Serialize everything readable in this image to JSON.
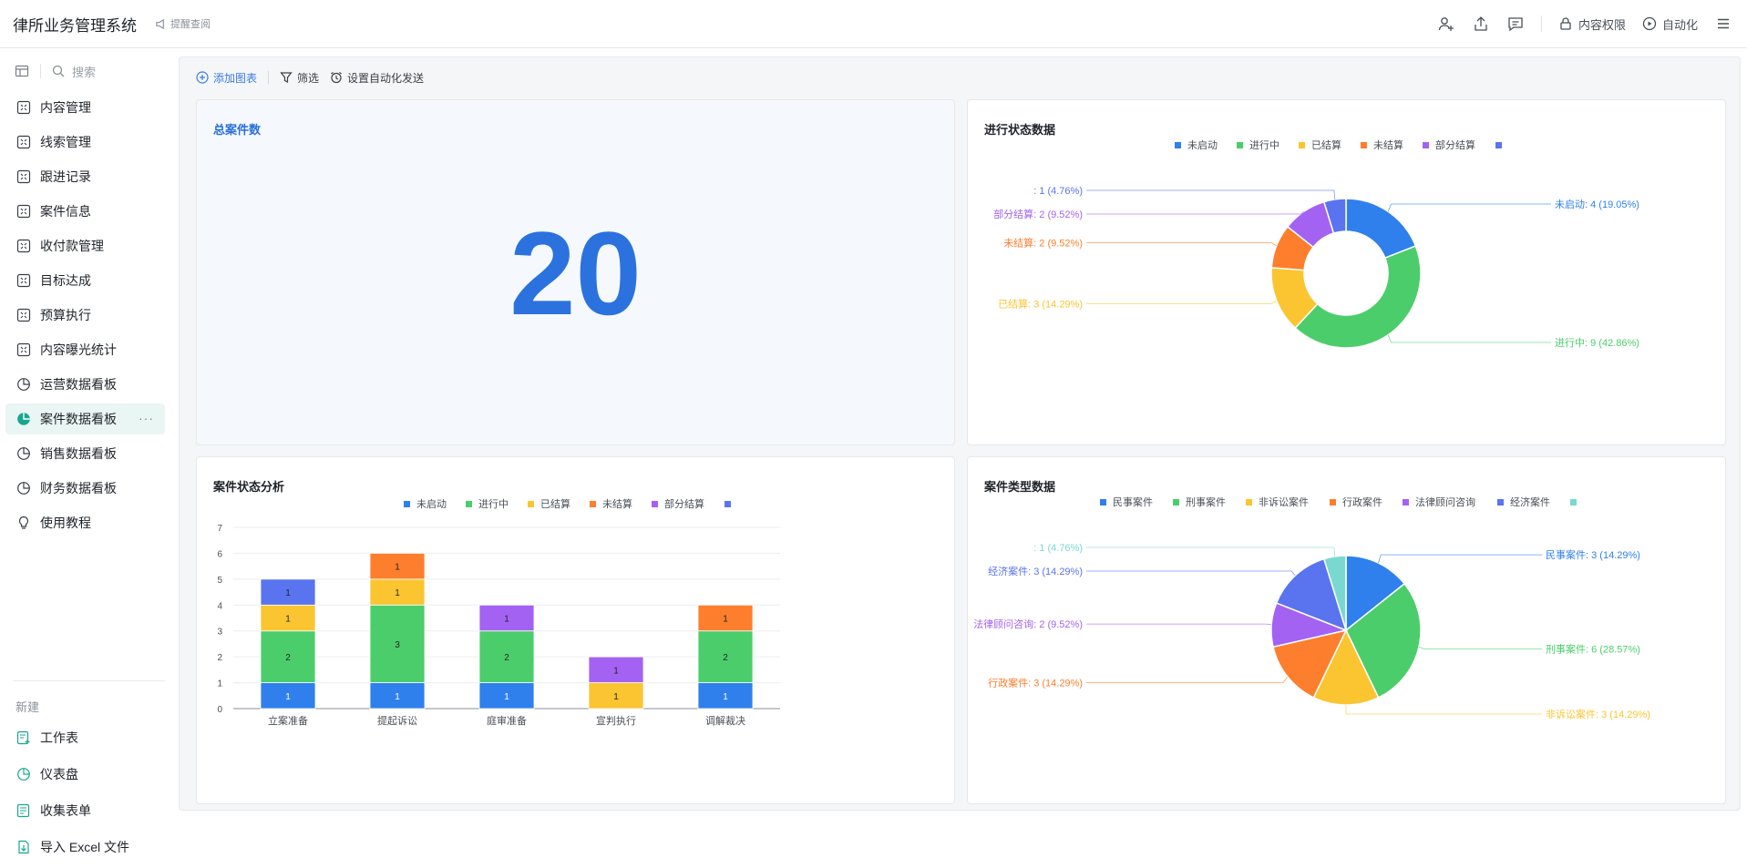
{
  "header": {
    "title": "律所业务管理系统",
    "hint": "提醒查阅",
    "buttons": {
      "permission": "内容权限",
      "automation": "自动化"
    }
  },
  "sidebar": {
    "search_placeholder": "搜索",
    "items": [
      {
        "label": "内容管理",
        "icon": "table-icon"
      },
      {
        "label": "线索管理",
        "icon": "table-icon"
      },
      {
        "label": "跟进记录",
        "icon": "table-icon"
      },
      {
        "label": "案件信息",
        "icon": "table-icon"
      },
      {
        "label": "收付款管理",
        "icon": "table-icon"
      },
      {
        "label": "目标达成",
        "icon": "table-icon"
      },
      {
        "label": "预算执行",
        "icon": "table-icon"
      },
      {
        "label": "内容曝光统计",
        "icon": "table-icon"
      },
      {
        "label": "运营数据看板",
        "icon": "pie-icon"
      },
      {
        "label": "案件数据看板",
        "icon": "pie-icon",
        "active": true,
        "more": "···"
      },
      {
        "label": "销售数据看板",
        "icon": "pie-icon"
      },
      {
        "label": "财务数据看板",
        "icon": "pie-icon"
      },
      {
        "label": "使用教程",
        "icon": "bulb-icon"
      }
    ],
    "new_section": {
      "label": "新建",
      "items": [
        {
          "label": "工作表",
          "icon": "sheet-icon"
        },
        {
          "label": "仪表盘",
          "icon": "dashboard-icon"
        },
        {
          "label": "收集表单",
          "icon": "form-icon"
        },
        {
          "label": "导入 Excel 文件",
          "icon": "import-icon"
        }
      ]
    }
  },
  "toolbar": {
    "add_chart": "添加图表",
    "filter": "筛选",
    "auto_send": "设置自动化发送"
  },
  "cards": {
    "total": {
      "title": "总案件数",
      "value": "20"
    },
    "status_pie": {
      "title": "进行状态数据"
    },
    "stacked": {
      "title": "案件状态分析"
    },
    "type_pie": {
      "title": "案件类型数据"
    }
  },
  "chart_data": [
    {
      "type": "pie",
      "variant": "donut",
      "title": "进行状态数据",
      "legend_position": "top",
      "legend": [
        "未启动",
        "进行中",
        "已结算",
        "未结算",
        "部分结算",
        ""
      ],
      "slices": [
        {
          "name": "未启动",
          "value": 4,
          "label": "未启动: 4 (19.05%)",
          "color": "#2f80ed"
        },
        {
          "name": "进行中",
          "value": 9,
          "label": "进行中: 9 (42.86%)",
          "color": "#4ccd6b"
        },
        {
          "name": "已结算",
          "value": 3,
          "label": "已结算: 3 (14.29%)",
          "color": "#fbc531"
        },
        {
          "name": "未结算",
          "value": 2,
          "label": "未结算: 2 (9.52%)",
          "color": "#fd7e2d"
        },
        {
          "name": "部分结算",
          "value": 2,
          "label": "部分结算: 2 (9.52%)",
          "color": "#a462f2"
        },
        {
          "name": "",
          "value": 1,
          "label": ": 1 (4.76%)",
          "color": "#5a74ef"
        }
      ]
    },
    {
      "type": "bar",
      "stacked": true,
      "title": "案件状态分析",
      "legend_position": "top",
      "categories": [
        "立案准备",
        "提起诉讼",
        "庭审准备",
        "宣判执行",
        "调解裁决"
      ],
      "ylim": [
        0,
        7
      ],
      "yticks": [
        "0",
        "1",
        "2",
        "3",
        "4",
        "5",
        "6",
        "7"
      ],
      "grid": true,
      "series": [
        {
          "name": "未启动",
          "color": "#2f80ed",
          "values": [
            1,
            1,
            1,
            0,
            1
          ]
        },
        {
          "name": "进行中",
          "color": "#4ccd6b",
          "values": [
            2,
            3,
            2,
            0,
            2
          ]
        },
        {
          "name": "已结算",
          "color": "#fbc531",
          "values": [
            1,
            1,
            0,
            1,
            0
          ]
        },
        {
          "name": "未结算",
          "color": "#fd7e2d",
          "values": [
            0,
            1,
            0,
            0,
            1
          ]
        },
        {
          "name": "部分结算",
          "color": "#a462f2",
          "values": [
            0,
            0,
            1,
            1,
            0
          ]
        },
        {
          "name": "",
          "color": "#5a74ef",
          "values": [
            1,
            0,
            0,
            0,
            0
          ]
        }
      ]
    },
    {
      "type": "pie",
      "title": "案件类型数据",
      "legend_position": "top",
      "legend": [
        "民事案件",
        "刑事案件",
        "非诉讼案件",
        "行政案件",
        "法律顾问咨询",
        "经济案件",
        ""
      ],
      "slices": [
        {
          "name": "民事案件",
          "value": 3,
          "label": "民事案件: 3 (14.29%)",
          "color": "#2f80ed"
        },
        {
          "name": "刑事案件",
          "value": 6,
          "label": "刑事案件: 6 (28.57%)",
          "color": "#4ccd6b"
        },
        {
          "name": "非诉讼案件",
          "value": 3,
          "label": "非诉讼案件: 3 (14.29%)",
          "color": "#fbc531"
        },
        {
          "name": "行政案件",
          "value": 3,
          "label": "行政案件: 3 (14.29%)",
          "color": "#fd7e2d"
        },
        {
          "name": "法律顾问咨询",
          "value": 2,
          "label": "法律顾问咨询: 2 (9.52%)",
          "color": "#a462f2"
        },
        {
          "name": "经济案件",
          "value": 3,
          "label": "经济案件: 3 (14.29%)",
          "color": "#5a74ef"
        },
        {
          "name": "",
          "value": 1,
          "label": ": 1 (4.76%)",
          "color": "#79d9d1"
        }
      ]
    }
  ]
}
